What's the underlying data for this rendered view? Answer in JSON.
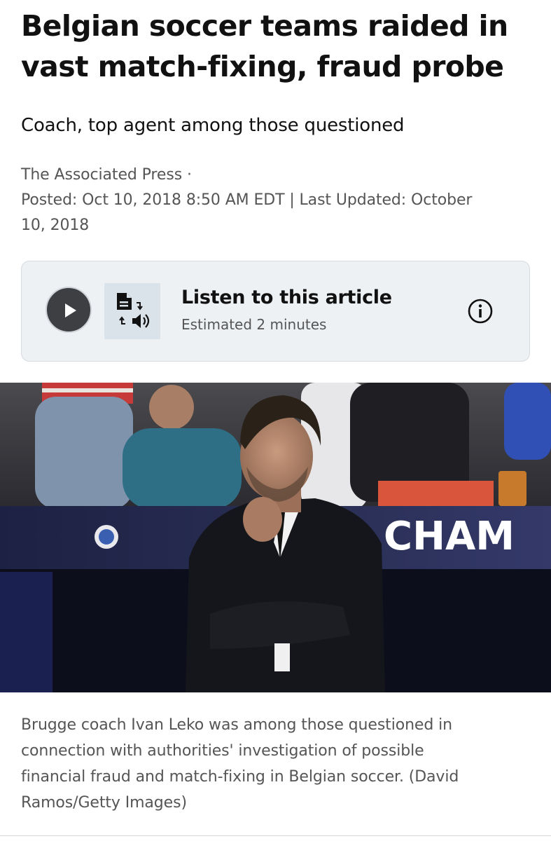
{
  "article": {
    "headline_line1": "Belgian soccer teams raided in",
    "headline_line2": "vast match-fixing, fraud probe",
    "deck": "Coach, top agent among those questioned",
    "source": "The Associated Press ·",
    "posted_line1": "Posted: Oct 10, 2018 8:50 AM EDT | Last Updated: October",
    "posted_line2": "10, 2018"
  },
  "listen": {
    "title": "Listen to this article",
    "estimate": "Estimated 2 minutes",
    "play_icon": "play-icon",
    "tts_icon": "text-to-speech-icon",
    "info_icon": "info-icon"
  },
  "photo": {
    "banner_text": "CHAM",
    "caption_line1": "Brugge coach Ivan Leko was among those questioned in",
    "caption_line2": "connection with authorities' investigation of possible",
    "caption_line3": "financial fraud and match-fixing in Belgian soccer. (David",
    "caption_line4": "Ramos/Getty Images)"
  },
  "colors": {
    "card_bg": "#eef1f4",
    "play_bg": "#3d3f43",
    "meta_text": "#555555"
  }
}
